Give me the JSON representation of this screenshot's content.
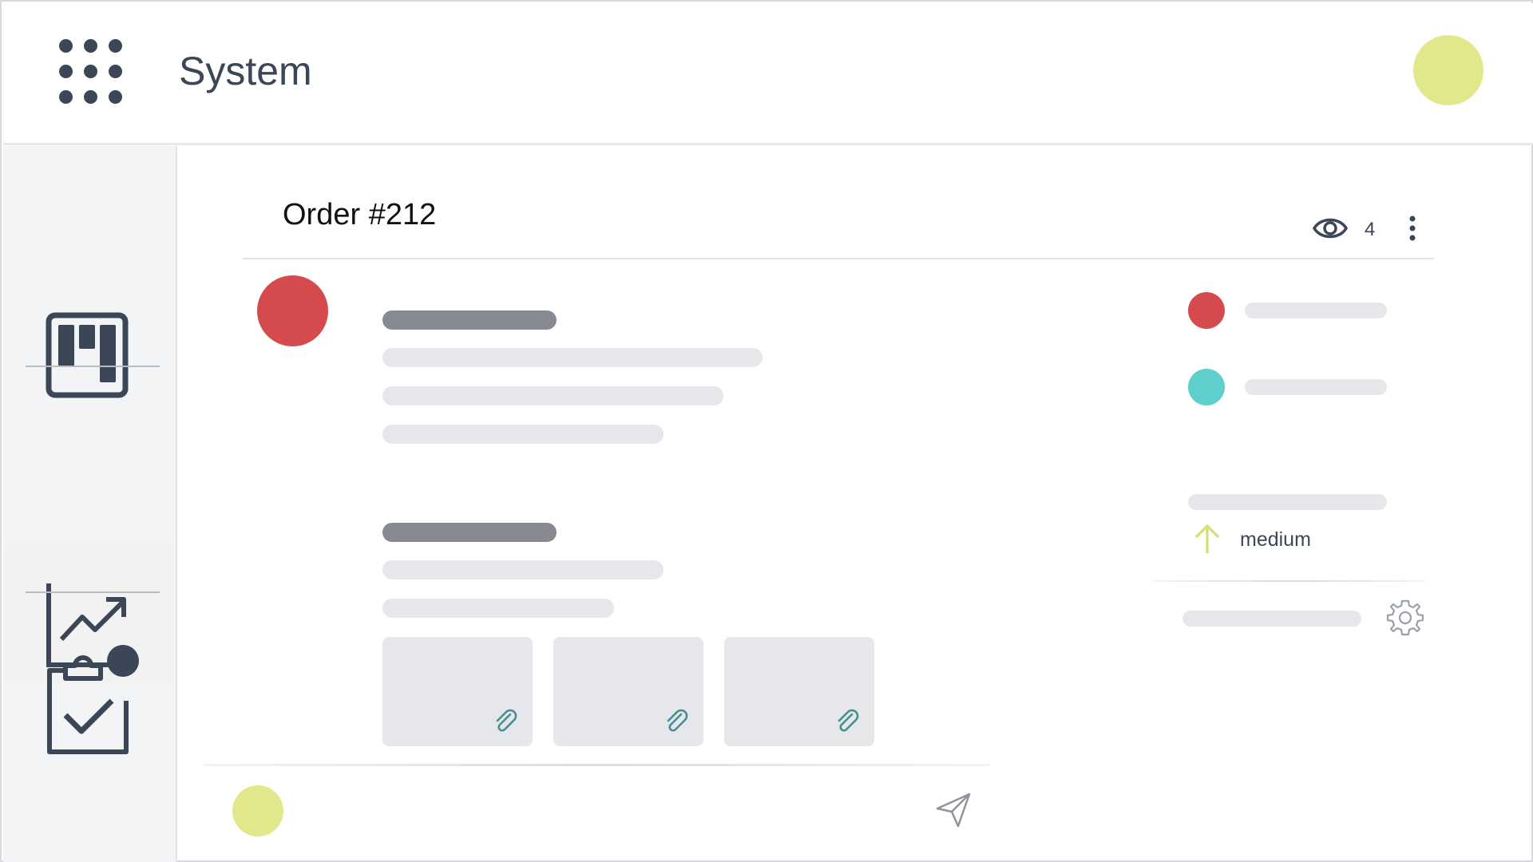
{
  "header": {
    "app_title": "System",
    "apps_icon": "apps-grid-icon"
  },
  "sidebar": {
    "items": [
      {
        "icon": "board-icon"
      },
      {
        "icon": "chart-trend-icon"
      },
      {
        "icon": "clipboard-check-icon",
        "has_notification": true
      }
    ]
  },
  "order": {
    "title": "Order #212",
    "watchers_count": "4",
    "attachments": [
      {
        "icon": "paperclip-icon"
      },
      {
        "icon": "paperclip-icon"
      },
      {
        "icon": "paperclip-icon"
      }
    ]
  },
  "side_panel": {
    "priority_label": "medium",
    "priority_icon": "arrow-up-icon"
  },
  "colors": {
    "accent_yellow": "#e2e78c",
    "red": "#d54b4d",
    "teal": "#5ecfcc",
    "text_dark": "#3b4656",
    "placeholder_dark": "#878a92",
    "placeholder_light": "#e6e7eb"
  }
}
